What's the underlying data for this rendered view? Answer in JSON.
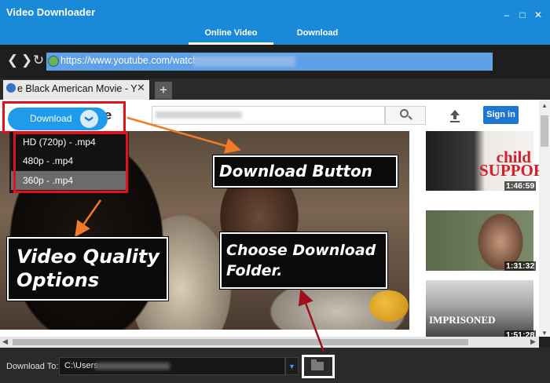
{
  "app": {
    "title": "Video Downloader",
    "minimize_glyph": "–",
    "maximize_glyph": "□",
    "close_glyph": "✕",
    "tabs": [
      {
        "label": "Online Video",
        "active": true
      },
      {
        "label": "Download",
        "active": false
      }
    ]
  },
  "navigation": {
    "back_glyph": "❮",
    "forward_glyph": "❯",
    "reload_glyph": "↻",
    "url": "https://www.youtube.com/watch"
  },
  "browser_tab": {
    "title": "e Black American Movie - Y",
    "close_glyph": "✕",
    "new_tab_glyph": "+"
  },
  "webpage": {
    "logo_fragment": "ube",
    "sign_in_label": "Sign in",
    "thumbnails": [
      {
        "title_text": "child SUPPORT",
        "duration": "1:46:59"
      },
      {
        "title_text": "",
        "duration": "1:31:32"
      },
      {
        "title_text": "IMPRISONED",
        "duration": "1:51:28"
      }
    ]
  },
  "download_widget": {
    "button_label": "Download",
    "chevron_glyph": "❯",
    "quality_options": [
      {
        "label": "HD (720p) - .mp4",
        "selected": false
      },
      {
        "label": "480p - .mp4",
        "selected": false
      },
      {
        "label": "360p - .mp4",
        "selected": true
      }
    ]
  },
  "bottom_bar": {
    "label": "Download To:",
    "path": "C:\\Users",
    "dropdown_glyph": "▼"
  },
  "annotations": {
    "download_button": "Download Button",
    "quality_options": "Video Quality Options",
    "choose_folder": "Choose Download Folder.",
    "arrow_colors": {
      "orange": "#f07c2a",
      "red": "#a0101a"
    }
  },
  "colors": {
    "title_bar": "#1a8ad8",
    "accent_button": "#1e9bea",
    "highlight_box": "#e2121d",
    "sign_in": "#1f76d2"
  }
}
